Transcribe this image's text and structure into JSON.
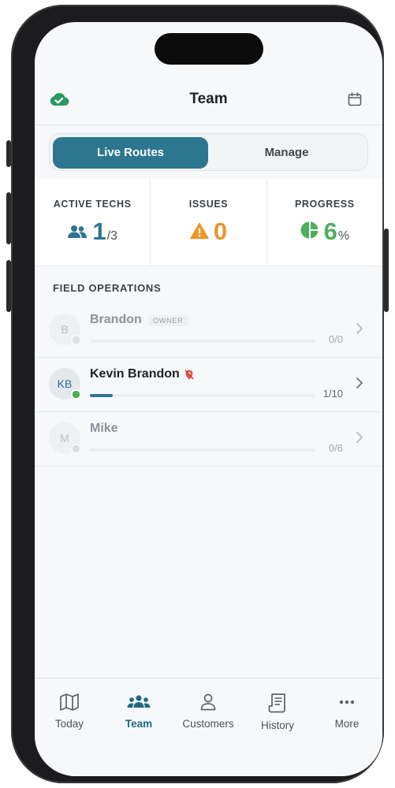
{
  "header": {
    "title": "Team"
  },
  "segmented": {
    "live_label": "Live Routes",
    "manage_label": "Manage"
  },
  "stats": {
    "active_techs": {
      "label": "ACTIVE TECHS",
      "value": "1",
      "total": "/3"
    },
    "issues": {
      "label": "ISSUES",
      "value": "0"
    },
    "progress": {
      "label": "PROGRESS",
      "value": "6",
      "unit": "%",
      "fraction": 0.06
    }
  },
  "section_title": "FIELD OPERATIONS",
  "techs": [
    {
      "initials": "B",
      "name": "Brandon",
      "badge": "OWNER",
      "count": "0/0",
      "progress": 0,
      "status": "offline"
    },
    {
      "initials": "KB",
      "name": "Kevin Brandon",
      "count": "1/10",
      "progress": 0.1,
      "status": "online"
    },
    {
      "initials": "M",
      "name": "Mike",
      "count": "0/6",
      "progress": 0,
      "status": "offline"
    }
  ],
  "tabbar": {
    "today": "Today",
    "team": "Team",
    "customers": "Customers",
    "history": "History",
    "more": "More"
  },
  "colors": {
    "accent": "#2d7690",
    "warning": "#e9962a",
    "success": "#4fae5c",
    "online": "#4caf50"
  }
}
